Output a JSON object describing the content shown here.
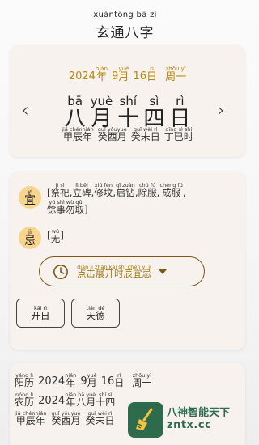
{
  "app": {
    "title_pinyin": "xuántōng bā zì",
    "title": "玄通八字"
  },
  "solar": {
    "year": "2024",
    "nian_py": "nián",
    "nian": "年",
    "month": "9",
    "yue_py": "yuè",
    "yue": "月",
    "day": "16",
    "ri_py": "rì",
    "ri": "日",
    "week_py": "zhōu yī",
    "week": "周一"
  },
  "lunar": {
    "chars": [
      {
        "py": "bā",
        "hz": "八"
      },
      {
        "py": "yuè",
        "hz": "月"
      },
      {
        "py": "shí",
        "hz": "十"
      },
      {
        "py": "sì",
        "hz": "四"
      },
      {
        "py": "rì",
        "hz": "日"
      }
    ]
  },
  "nav": {
    "prev": "‹",
    "next": "›"
  },
  "ganzhi": [
    {
      "py": "jiǎ chénnián",
      "hz": "甲辰年"
    },
    {
      "py": "guǐ yǒuyuè",
      "hz": "癸酉月"
    },
    {
      "py": "guǐ wèi rì",
      "hz": "癸未日"
    },
    {
      "py": "dīng sì shí",
      "hz": "丁巳时"
    }
  ],
  "yi": {
    "label_py": "yí",
    "label": "宜",
    "items": [
      {
        "py": "jì sì",
        "hz": "祭祀"
      },
      {
        "py": "lì bēi",
        "hz": "立碑"
      },
      {
        "py": "xiū fén",
        "hz": "修坟"
      },
      {
        "py": "qǐ zuàn",
        "hz": "启钻"
      },
      {
        "py": "chú fú",
        "hz": "除服"
      },
      {
        "py": "chéng fú",
        "hz": "成服"
      },
      {
        "py": "yǔ shì wù qǔ",
        "hz": "馀事勿取"
      }
    ]
  },
  "ji": {
    "label_py": "jì",
    "label": "忌",
    "items": [
      {
        "py": "wú",
        "hz": "无"
      }
    ]
  },
  "time_button": {
    "py": "diǎn jī zhǎn kāi shí chén yí jì",
    "label": "点击展开时辰宜忌"
  },
  "buttons": [
    {
      "py": "kāi rì",
      "label": "开日"
    },
    {
      "py": "tiān dé",
      "label": "天德"
    }
  ],
  "bottom": {
    "solar": {
      "label_py": "yáng lì",
      "label": "阳历",
      "year": "2024",
      "nian_py": "nián",
      "nian": "年",
      "month": "9",
      "yue_py": "yuè",
      "yue": "月",
      "day": "16",
      "ri_py": "rì",
      "ri": "日",
      "week_py": "zhōu yī",
      "week": "周一"
    },
    "lunar": {
      "label_py": "nóng lì",
      "label": "农历",
      "year": "2024",
      "nian_py": "nián",
      "nian": "年",
      "month_py": "bā",
      "month": "八",
      "yue_py": "yuè",
      "yue": "月",
      "day_py": "shí sì",
      "day": "十四"
    },
    "ganzhi": [
      {
        "py": "jiǎ chénnián",
        "hz": "甲辰年"
      },
      {
        "py": "guǐ yǒuyuè",
        "hz": "癸酉月"
      },
      {
        "py": "guǐ wèi rì",
        "hz": "癸未日"
      }
    ]
  },
  "watermark": {
    "name": "八神智能天下",
    "url": "zntx.cc"
  },
  "colors": {
    "accent": "#b8860b",
    "badge": "#f7d58e",
    "card": "#f7f2ee",
    "watermark": "#2e6b4d"
  }
}
